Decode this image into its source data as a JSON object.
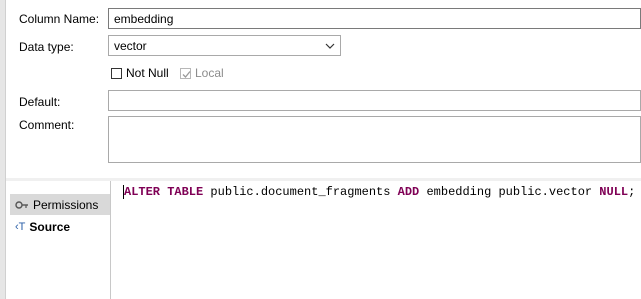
{
  "form": {
    "column_name_label": "Column Name:",
    "column_name_value": "embedding",
    "data_type_label": "Data type:",
    "data_type_value": "vector",
    "not_null_label": "Not Null",
    "local_label": "Local",
    "default_label": "Default:",
    "default_value": "",
    "comment_label": "Comment:",
    "comment_value": ""
  },
  "tabs": [
    {
      "label": "Permissions",
      "icon": "key-icon"
    },
    {
      "label": "Source",
      "icon": "source-icon"
    }
  ],
  "source": {
    "k1": "ALTER TABLE",
    "t1": " public.document_fragments ",
    "k2": "ADD",
    "t2": " embedding public.vector ",
    "k3": "NULL",
    "t3": ";"
  },
  "colors": {
    "keyword": "#7f0055",
    "inactive_tab": "#d9d9d9",
    "panel_bg": "#f0f0f0"
  }
}
